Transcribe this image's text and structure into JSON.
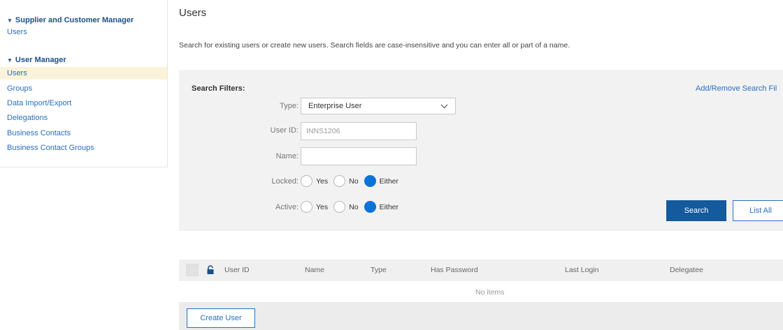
{
  "sidebar": {
    "sections": [
      {
        "title": "Supplier and Customer Manager",
        "items": [
          {
            "label": "Users"
          }
        ]
      },
      {
        "title": "User Manager",
        "items": [
          {
            "label": "Users",
            "active": true
          },
          {
            "label": "Groups"
          },
          {
            "label": "Data Import/Export"
          },
          {
            "label": "Delegations"
          },
          {
            "label": "Business Contacts"
          },
          {
            "label": "Business Contact Groups"
          }
        ]
      }
    ]
  },
  "page": {
    "title": "Users",
    "description": "Search for existing users or create new users.  Search fields are case-insensitive and you can enter all or part of a name."
  },
  "filters": {
    "title": "Search Filters:",
    "add_remove": "Add/Remove Search Fil",
    "type_label": "Type:",
    "type_value": "Enterprise User",
    "userid_label": "User ID:",
    "userid_placeholder": "INNS1206",
    "name_label": "Name:",
    "name_value": "",
    "locked_label": "Locked:",
    "active_label": "Active:",
    "radio_options": [
      "Yes",
      "No",
      "Either"
    ],
    "locked_selected": "Either",
    "active_selected": "Either",
    "search_button": "Search",
    "list_all_button": "List All"
  },
  "table": {
    "columns": [
      "User ID",
      "Name",
      "Type",
      "Has Password",
      "Last Login",
      "Delegatee"
    ],
    "empty_text": "No items",
    "create_button": "Create User"
  },
  "colors": {
    "accent": "#145a9c",
    "link": "#2a6ebb",
    "radio_checked": "#0a73d8",
    "active_row": "#fbf3d9"
  }
}
